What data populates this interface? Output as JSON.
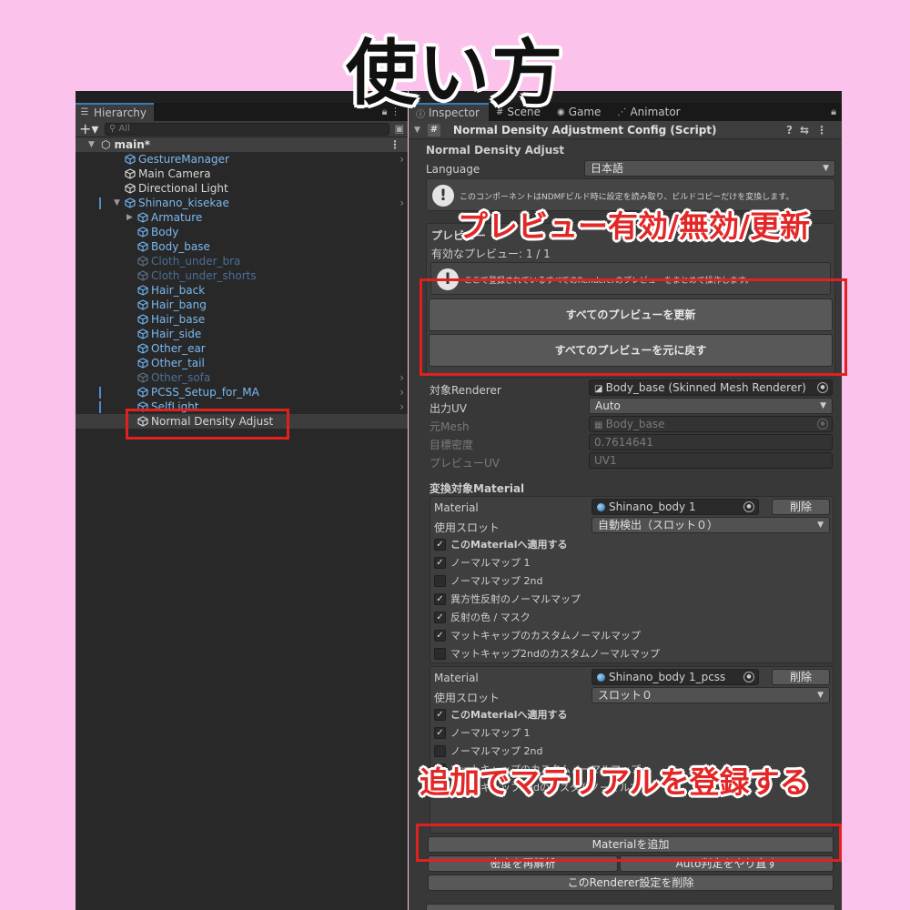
{
  "headline": "使い方",
  "annotations": {
    "preview": "プレビュー有効/無効/更新",
    "add_material": "追加でマテリアルを登録する"
  },
  "hierarchy": {
    "tab_label": "Hierarchy",
    "search_placeholder": "All",
    "scene": "main*",
    "items": [
      {
        "label": "GestureManager",
        "color": "blue",
        "indent": 0,
        "arrow": true
      },
      {
        "label": "Main Camera",
        "color": "white",
        "indent": 0
      },
      {
        "label": "Directional Light",
        "color": "white",
        "indent": 0
      },
      {
        "label": "Shinano_kisekae",
        "color": "blue",
        "indent": 0,
        "arrow": true,
        "fold": "▼"
      },
      {
        "label": "Armature",
        "color": "blue",
        "indent": 1,
        "fold": "▶"
      },
      {
        "label": "Body",
        "color": "blue",
        "indent": 1
      },
      {
        "label": "Body_base",
        "color": "blue",
        "indent": 1
      },
      {
        "label": "Cloth_under_bra",
        "color": "dim",
        "indent": 1
      },
      {
        "label": "Cloth_under_shorts",
        "color": "dim",
        "indent": 1
      },
      {
        "label": "Hair_back",
        "color": "blue",
        "indent": 1
      },
      {
        "label": "Hair_bang",
        "color": "blue",
        "indent": 1
      },
      {
        "label": "Hair_base",
        "color": "blue",
        "indent": 1
      },
      {
        "label": "Hair_side",
        "color": "blue",
        "indent": 1
      },
      {
        "label": "Other_ear",
        "color": "blue",
        "indent": 1
      },
      {
        "label": "Other_tail",
        "color": "blue",
        "indent": 1
      },
      {
        "label": "Other_sofa",
        "color": "dim",
        "indent": 1,
        "arrow": true
      },
      {
        "label": "PCSS_Setup_for_MA",
        "color": "blue",
        "indent": 1,
        "arrow": true
      },
      {
        "label": "SelfLight",
        "color": "blue",
        "indent": 1,
        "arrow": true
      },
      {
        "label": "Normal Density Adjust",
        "color": "white",
        "indent": 1,
        "selected": true
      }
    ]
  },
  "inspector": {
    "tabs": [
      "Inspector",
      "Scene",
      "Game",
      "Animator"
    ],
    "component_title": "Normal Density Adjustment Config (Script)",
    "section_title": "Normal Density Adjust",
    "language_label": "Language",
    "language_value": "日本語",
    "help1": "このコンポーネントはNDMFビルド時に設定を読み取り、ビルドコピーだけを変換します。",
    "preview_title": "プレビュー",
    "preview_count": "有効なプレビュー: 1 / 1",
    "help2": "ここで登録されているすべてのRendererのプレビューをまとめて操作します。",
    "btn_refresh_all": "すべてのプレビューを更新",
    "btn_restore_all": "すべてのプレビューを元に戻す",
    "target_renderer_label": "対象Renderer",
    "target_renderer_value": "Body_base (Skinned Mesh Renderer)",
    "output_uv_label": "出力UV",
    "output_uv_value": "Auto",
    "src_mesh_label": "元Mesh",
    "src_mesh_value": "Body_base",
    "target_density_label": "目標密度",
    "target_density_value": "0.7614641",
    "preview_uv_label": "プレビューUV",
    "preview_uv_value": "UV1",
    "materials_title": "変換対象Material",
    "material_label": "Material",
    "slot_label": "使用スロット",
    "delete_label": "削除",
    "materials": [
      {
        "name": "Shinano_body 1",
        "slot": "自動検出（スロット０）",
        "checks": [
          {
            "label": "このMaterialへ適用する",
            "checked": true,
            "bold": true
          },
          {
            "label": "ノーマルマップ 1",
            "checked": true
          },
          {
            "label": "ノーマルマップ 2nd",
            "checked": false
          },
          {
            "label": "異方性反射のノーマルマップ",
            "checked": true
          },
          {
            "label": "反射の色 / マスク",
            "checked": true
          },
          {
            "label": "マットキャップのカスタムノーマルマップ",
            "checked": true
          },
          {
            "label": "マットキャップ2ndのカスタムノーマルマップ",
            "checked": false
          }
        ]
      },
      {
        "name": "Shinano_body 1_pcss",
        "slot": "スロット０",
        "checks": [
          {
            "label": "このMaterialへ適用する",
            "checked": true,
            "bold": true
          },
          {
            "label": "ノーマルマップ 1",
            "checked": true
          },
          {
            "label": "ノーマルマップ 2nd",
            "checked": false
          },
          {
            "label": "マットキャップのカスタムノーマルマップ",
            "checked": true
          },
          {
            "label": "マットキャップ2ndのカスタムノーマルマップ",
            "checked": false
          }
        ]
      }
    ],
    "btn_add_material": "Materialを追加",
    "btn_reanalyze": "密度を再解析",
    "btn_auto": "Auto判定をやり直す",
    "btn_delete_renderer": "このRenderer設定を削除"
  }
}
